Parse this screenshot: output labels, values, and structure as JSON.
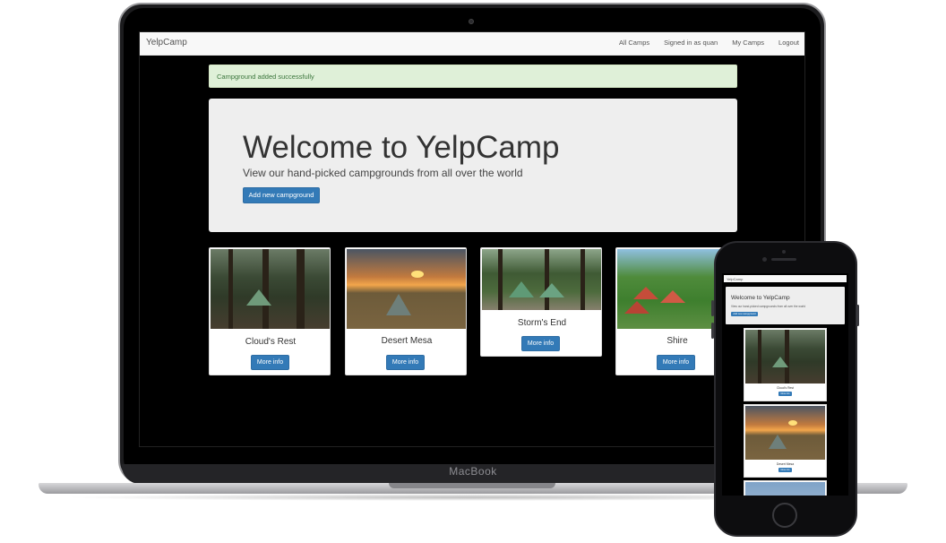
{
  "device_brand": "MacBook",
  "navbar": {
    "brand": "YelpCamp",
    "links": [
      "All Camps",
      "Signed in as quan",
      "My Camps",
      "Logout"
    ]
  },
  "alert": {
    "text": "Campground added successfully"
  },
  "jumbotron": {
    "title": "Welcome to YelpCamp",
    "subtitle": "View our hand-picked campgrounds from all over the world",
    "button": "Add new campground"
  },
  "campgrounds": [
    {
      "name": "Cloud's Rest",
      "button": "More info"
    },
    {
      "name": "Desert Mesa",
      "button": "More info"
    },
    {
      "name": "Storm's End",
      "button": "More info"
    },
    {
      "name": "Shire",
      "button": "More info"
    }
  ],
  "colors": {
    "primary": "#337ab7",
    "alert_bg": "#dff0d8",
    "alert_text": "#3c763d",
    "jumbotron_bg": "#eeeeee"
  }
}
